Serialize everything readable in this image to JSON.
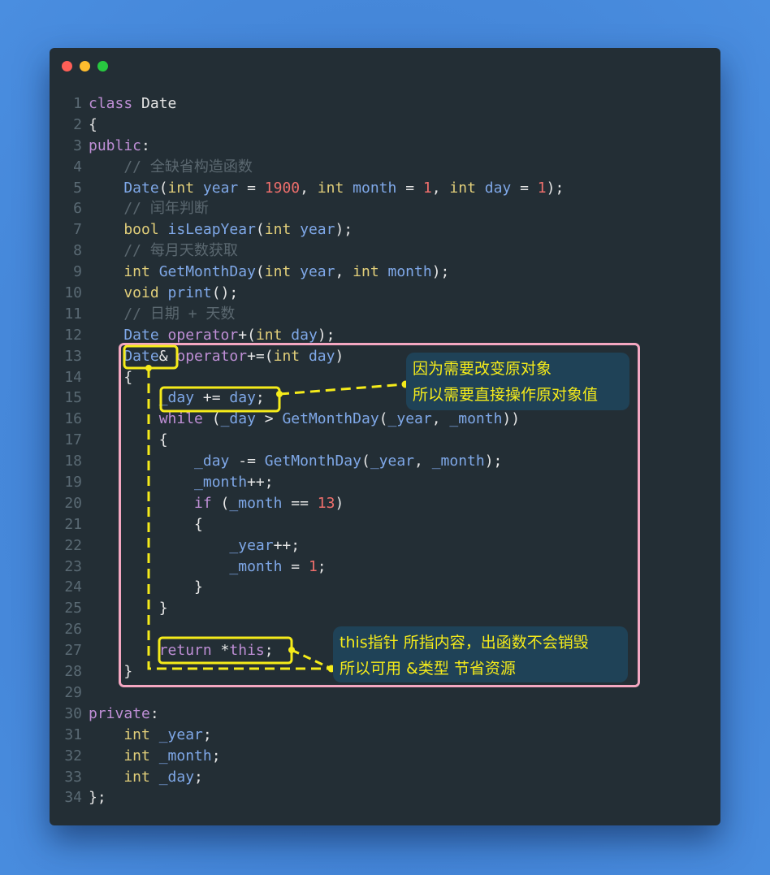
{
  "window": {
    "controls": [
      "close",
      "minimize",
      "maximize"
    ],
    "colors": {
      "close": "#fe5f57",
      "minimize": "#febc2e",
      "maximize": "#28c840",
      "background": "#232e35",
      "page_background": "#4384d6"
    }
  },
  "code": {
    "language": "C++",
    "lines": [
      {
        "n": "1",
        "tokens": [
          [
            "kw",
            "class"
          ],
          [
            "pl",
            " Date"
          ]
        ]
      },
      {
        "n": "2",
        "tokens": [
          [
            "pl",
            "{"
          ]
        ]
      },
      {
        "n": "3",
        "tokens": [
          [
            "kw",
            "public"
          ],
          [
            "pl",
            ":"
          ]
        ]
      },
      {
        "n": "4",
        "tokens": [
          [
            "cm",
            "    // 全缺省构造函数"
          ]
        ]
      },
      {
        "n": "5",
        "tokens": [
          [
            "fn",
            "    Date"
          ],
          [
            "pl",
            "("
          ],
          [
            "ty",
            "int"
          ],
          [
            "fn",
            " year"
          ],
          [
            "pl",
            " = "
          ],
          [
            "nm",
            "1900"
          ],
          [
            "pl",
            ", "
          ],
          [
            "ty",
            "int"
          ],
          [
            "fn",
            " month"
          ],
          [
            "pl",
            " = "
          ],
          [
            "nm",
            "1"
          ],
          [
            "pl",
            ", "
          ],
          [
            "ty",
            "int"
          ],
          [
            "fn",
            " day"
          ],
          [
            "pl",
            " = "
          ],
          [
            "nm",
            "1"
          ],
          [
            "pl",
            ");"
          ]
        ]
      },
      {
        "n": "6",
        "tokens": [
          [
            "cm",
            "    // 闰年判断"
          ]
        ]
      },
      {
        "n": "7",
        "tokens": [
          [
            "ty",
            "    bool"
          ],
          [
            "fn",
            " isLeapYear"
          ],
          [
            "pl",
            "("
          ],
          [
            "ty",
            "int"
          ],
          [
            "fn",
            " year"
          ],
          [
            "pl",
            ");"
          ]
        ]
      },
      {
        "n": "8",
        "tokens": [
          [
            "cm",
            "    // 每月天数获取"
          ]
        ]
      },
      {
        "n": "9",
        "tokens": [
          [
            "ty",
            "    int"
          ],
          [
            "fn",
            " GetMonthDay"
          ],
          [
            "pl",
            "("
          ],
          [
            "ty",
            "int"
          ],
          [
            "fn",
            " year"
          ],
          [
            "pl",
            ", "
          ],
          [
            "ty",
            "int"
          ],
          [
            "fn",
            " month"
          ],
          [
            "pl",
            ");"
          ]
        ]
      },
      {
        "n": "10",
        "tokens": [
          [
            "ty",
            "    void"
          ],
          [
            "fn",
            " print"
          ],
          [
            "pl",
            "();"
          ]
        ]
      },
      {
        "n": "11",
        "tokens": [
          [
            "cm",
            "    // 日期 + 天数"
          ]
        ]
      },
      {
        "n": "12",
        "tokens": [
          [
            "fn",
            "    Date"
          ],
          [
            "kw",
            " operator"
          ],
          [
            "pl",
            "+("
          ],
          [
            "ty",
            "int"
          ],
          [
            "fn",
            " day"
          ],
          [
            "pl",
            ");"
          ]
        ]
      },
      {
        "n": "13",
        "tokens": [
          [
            "fn",
            "    Date"
          ],
          [
            "pl",
            "&"
          ],
          [
            "kw",
            " operator"
          ],
          [
            "pl",
            "+=("
          ],
          [
            "ty",
            "int"
          ],
          [
            "fn",
            " day"
          ],
          [
            "pl",
            ")"
          ]
        ]
      },
      {
        "n": "14",
        "tokens": [
          [
            "pl",
            "    {"
          ]
        ]
      },
      {
        "n": "15",
        "tokens": [
          [
            "fn",
            "        _day"
          ],
          [
            "pl",
            " += "
          ],
          [
            "fn",
            "day"
          ],
          [
            "pl",
            ";"
          ]
        ]
      },
      {
        "n": "16",
        "tokens": [
          [
            "kw",
            "        while"
          ],
          [
            "pl",
            " ("
          ],
          [
            "fn",
            "_day"
          ],
          [
            "pl",
            " > "
          ],
          [
            "fn",
            "GetMonthDay"
          ],
          [
            "pl",
            "("
          ],
          [
            "fn",
            "_year"
          ],
          [
            "pl",
            ", "
          ],
          [
            "fn",
            "_month"
          ],
          [
            "pl",
            "))"
          ]
        ]
      },
      {
        "n": "17",
        "tokens": [
          [
            "pl",
            "        {"
          ]
        ]
      },
      {
        "n": "18",
        "tokens": [
          [
            "fn",
            "            _day"
          ],
          [
            "pl",
            " -= "
          ],
          [
            "fn",
            "GetMonthDay"
          ],
          [
            "pl",
            "("
          ],
          [
            "fn",
            "_year"
          ],
          [
            "pl",
            ", "
          ],
          [
            "fn",
            "_month"
          ],
          [
            "pl",
            ");"
          ]
        ]
      },
      {
        "n": "19",
        "tokens": [
          [
            "fn",
            "            _month"
          ],
          [
            "pl",
            "++;"
          ]
        ]
      },
      {
        "n": "20",
        "tokens": [
          [
            "kw",
            "            if"
          ],
          [
            "pl",
            " ("
          ],
          [
            "fn",
            "_month"
          ],
          [
            "pl",
            " == "
          ],
          [
            "nm",
            "13"
          ],
          [
            "pl",
            ")"
          ]
        ]
      },
      {
        "n": "21",
        "tokens": [
          [
            "pl",
            "            {"
          ]
        ]
      },
      {
        "n": "22",
        "tokens": [
          [
            "fn",
            "                _year"
          ],
          [
            "pl",
            "++;"
          ]
        ]
      },
      {
        "n": "23",
        "tokens": [
          [
            "fn",
            "                _month"
          ],
          [
            "pl",
            " = "
          ],
          [
            "nm",
            "1"
          ],
          [
            "pl",
            ";"
          ]
        ]
      },
      {
        "n": "24",
        "tokens": [
          [
            "pl",
            "            }"
          ]
        ]
      },
      {
        "n": "25",
        "tokens": [
          [
            "pl",
            "        }"
          ]
        ]
      },
      {
        "n": "26",
        "tokens": [
          [
            "pl",
            ""
          ]
        ]
      },
      {
        "n": "27",
        "tokens": [
          [
            "kw",
            "        return"
          ],
          [
            "pl",
            " *"
          ],
          [
            "kw",
            "this"
          ],
          [
            "pl",
            ";"
          ]
        ]
      },
      {
        "n": "28",
        "tokens": [
          [
            "pl",
            "    }"
          ]
        ]
      },
      {
        "n": "29",
        "tokens": [
          [
            "pl",
            ""
          ]
        ]
      },
      {
        "n": "30",
        "tokens": [
          [
            "kw",
            "private"
          ],
          [
            "pl",
            ":"
          ]
        ]
      },
      {
        "n": "31",
        "tokens": [
          [
            "ty",
            "    int"
          ],
          [
            "fn",
            " _year"
          ],
          [
            "pl",
            ";"
          ]
        ]
      },
      {
        "n": "32",
        "tokens": [
          [
            "ty",
            "    int"
          ],
          [
            "fn",
            " _month"
          ],
          [
            "pl",
            ";"
          ]
        ]
      },
      {
        "n": "33",
        "tokens": [
          [
            "ty",
            "    int"
          ],
          [
            "fn",
            " _day"
          ],
          [
            "pl",
            ";"
          ]
        ]
      },
      {
        "n": "34",
        "tokens": [
          [
            "pl",
            "};"
          ]
        ]
      }
    ]
  },
  "annotations": {
    "highlight_color": "#f5eb1a",
    "frame_color": "#f4a7c1",
    "callout1": {
      "line1": "因为需要改变原对象",
      "line2": "所以需要直接操作原对象值"
    },
    "callout2": {
      "line1": "this指针 所指内容，出函数不会销毁",
      "line2": "所以可用 &类型 节省资源"
    }
  }
}
